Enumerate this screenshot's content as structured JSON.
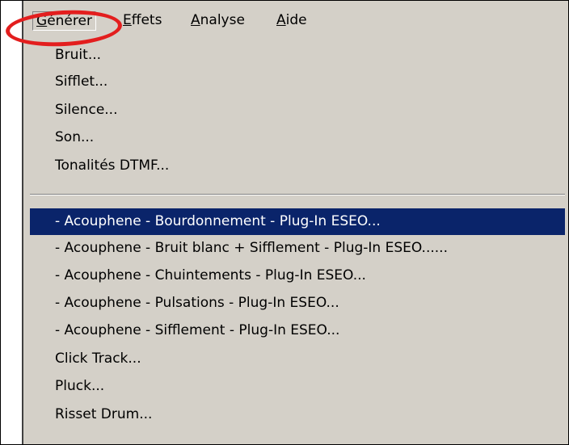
{
  "menubar": {
    "generer": {
      "accel": "G",
      "rest": "énérer"
    },
    "effets": {
      "accel": "E",
      "rest": "ffets"
    },
    "analyse": {
      "accel": "A",
      "rest": "nalyse"
    },
    "aide": {
      "accel": "A",
      "rest": "ide"
    }
  },
  "menu": {
    "group1": [
      "Bruit...",
      "Sifflet...",
      "Silence...",
      "Son...",
      "Tonalités DTMF..."
    ],
    "group2": [
      "- Acouphene - Bourdonnement - Plug-In ESEO...",
      "- Acouphene - Bruit blanc + Sifflement - Plug-In ESEO......",
      "- Acouphene - Chuintements - Plug-In ESEO...",
      "- Acouphene - Pulsations - Plug-In ESEO...",
      "- Acouphene - Sifflement - Plug-In ESEO...",
      "Click Track...",
      "Pluck...",
      "Risset Drum..."
    ]
  },
  "colors": {
    "menu_bg": "#d4d0c8",
    "selection_bg": "#0a246a",
    "annotation_ring": "#e31e1e"
  }
}
